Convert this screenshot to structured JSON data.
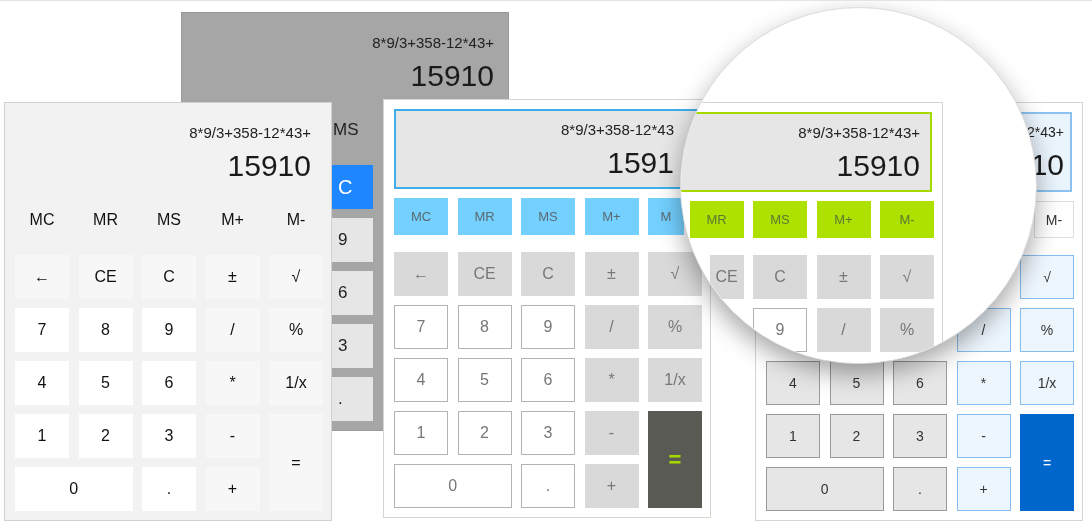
{
  "calculators": [
    {
      "kind": "grey",
      "magnified": false,
      "expression": "8*9/3+358-12*43+",
      "result": "15910",
      "memory_keys": [
        {
          "label": "MS"
        }
      ],
      "key_rows": [
        [
          {
            "label": "C",
            "kind": "function"
          }
        ],
        [
          {
            "label": "9",
            "kind": "digit"
          }
        ],
        [
          {
            "label": "6",
            "kind": "digit"
          }
        ],
        [
          {
            "label": "3",
            "kind": "digit"
          }
        ],
        [
          {
            "label": ".",
            "kind": "digit"
          }
        ]
      ]
    },
    {
      "kind": "light",
      "magnified": false,
      "expression": "8*9/3+358-12*43+",
      "result": "15910",
      "memory_keys": [
        {
          "label": "MC"
        },
        {
          "label": "MR"
        },
        {
          "label": "MS"
        },
        {
          "label": "M+"
        },
        {
          "label": "M-"
        }
      ],
      "key_rows": [
        [
          {
            "label": "←",
            "kind": "function"
          },
          {
            "label": "CE",
            "kind": "function"
          },
          {
            "label": "C",
            "kind": "function"
          },
          {
            "label": "±",
            "kind": "function"
          },
          {
            "label": "√",
            "kind": "function"
          }
        ],
        [
          {
            "label": "7",
            "kind": "digit"
          },
          {
            "label": "8",
            "kind": "digit"
          },
          {
            "label": "9",
            "kind": "digit"
          },
          {
            "label": "/",
            "kind": "function"
          },
          {
            "label": "%",
            "kind": "function"
          }
        ],
        [
          {
            "label": "4",
            "kind": "digit"
          },
          {
            "label": "5",
            "kind": "digit"
          },
          {
            "label": "6",
            "kind": "digit"
          },
          {
            "label": "*",
            "kind": "function"
          },
          {
            "label": "1/x",
            "kind": "function"
          }
        ],
        [
          {
            "label": "1",
            "kind": "digit"
          },
          {
            "label": "2",
            "kind": "digit"
          },
          {
            "label": "3",
            "kind": "digit"
          },
          {
            "label": "-",
            "kind": "function"
          },
          {
            "label": "=",
            "kind": "equals"
          }
        ],
        [
          {
            "label": "0",
            "kind": "digit"
          },
          {
            "label": ".",
            "kind": "digit"
          },
          {
            "label": "+",
            "kind": "function"
          }
        ]
      ]
    },
    {
      "kind": "sky",
      "magnified": false,
      "expression": "8*9/3+358-12*43",
      "result": "1591",
      "memory_keys": [
        {
          "label": "MC"
        },
        {
          "label": "MR"
        },
        {
          "label": "MS"
        },
        {
          "label": "M+"
        },
        {
          "label": "M"
        }
      ],
      "key_rows": [
        [
          {
            "label": "←",
            "kind": "function"
          },
          {
            "label": "CE",
            "kind": "function"
          },
          {
            "label": "C",
            "kind": "function"
          },
          {
            "label": "±",
            "kind": "function"
          },
          {
            "label": "√",
            "kind": "function"
          }
        ],
        [
          {
            "label": "7",
            "kind": "digit"
          },
          {
            "label": "8",
            "kind": "digit"
          },
          {
            "label": "9",
            "kind": "digit"
          },
          {
            "label": "/",
            "kind": "function"
          },
          {
            "label": "%",
            "kind": "function"
          }
        ],
        [
          {
            "label": "4",
            "kind": "digit"
          },
          {
            "label": "5",
            "kind": "digit"
          },
          {
            "label": "6",
            "kind": "digit"
          },
          {
            "label": "*",
            "kind": "function"
          },
          {
            "label": "1/x",
            "kind": "function"
          }
        ],
        [
          {
            "label": "1",
            "kind": "digit"
          },
          {
            "label": "2",
            "kind": "digit"
          },
          {
            "label": "3",
            "kind": "digit"
          },
          {
            "label": "-",
            "kind": "function"
          },
          {
            "label": "=",
            "kind": "equals"
          }
        ],
        [
          {
            "label": "0",
            "kind": "digit"
          },
          {
            "label": ".",
            "kind": "digit"
          },
          {
            "label": "+",
            "kind": "function"
          }
        ]
      ]
    },
    {
      "kind": "green",
      "magnified": true,
      "expression": "8*9/3+358-12*43+",
      "result": "15910",
      "memory_keys": [
        {
          "label": "MR"
        },
        {
          "label": "MS"
        },
        {
          "label": "M+"
        },
        {
          "label": "M-"
        }
      ],
      "key_rows": [
        [
          {
            "label": "CE",
            "kind": "function"
          },
          {
            "label": "C",
            "kind": "function"
          },
          {
            "label": "±",
            "kind": "function"
          },
          {
            "label": "√",
            "kind": "function"
          }
        ],
        [
          {
            "label": "9",
            "kind": "digit"
          },
          {
            "label": "/",
            "kind": "function"
          },
          {
            "label": "%",
            "kind": "function"
          }
        ]
      ]
    },
    {
      "kind": "blue",
      "magnified": false,
      "expression": "2*43+",
      "result": "10",
      "memory_keys": [
        {
          "label": "M-"
        }
      ],
      "key_rows": [
        [
          {
            "label": "√",
            "kind": "function"
          }
        ],
        [
          {
            "label": "/",
            "kind": "function"
          },
          {
            "label": "%",
            "kind": "function"
          }
        ],
        [
          {
            "label": "4",
            "kind": "digit"
          },
          {
            "label": "5",
            "kind": "digit"
          },
          {
            "label": "6",
            "kind": "digit"
          },
          {
            "label": "*",
            "kind": "function"
          },
          {
            "label": "1/x",
            "kind": "function"
          }
        ],
        [
          {
            "label": "1",
            "kind": "digit"
          },
          {
            "label": "2",
            "kind": "digit"
          },
          {
            "label": "3",
            "kind": "digit"
          },
          {
            "label": "-",
            "kind": "function"
          },
          {
            "label": "=",
            "kind": "equals"
          }
        ],
        [
          {
            "label": "0",
            "kind": "digit"
          },
          {
            "label": ".",
            "kind": "digit"
          },
          {
            "label": "+",
            "kind": "function"
          }
        ]
      ]
    }
  ]
}
